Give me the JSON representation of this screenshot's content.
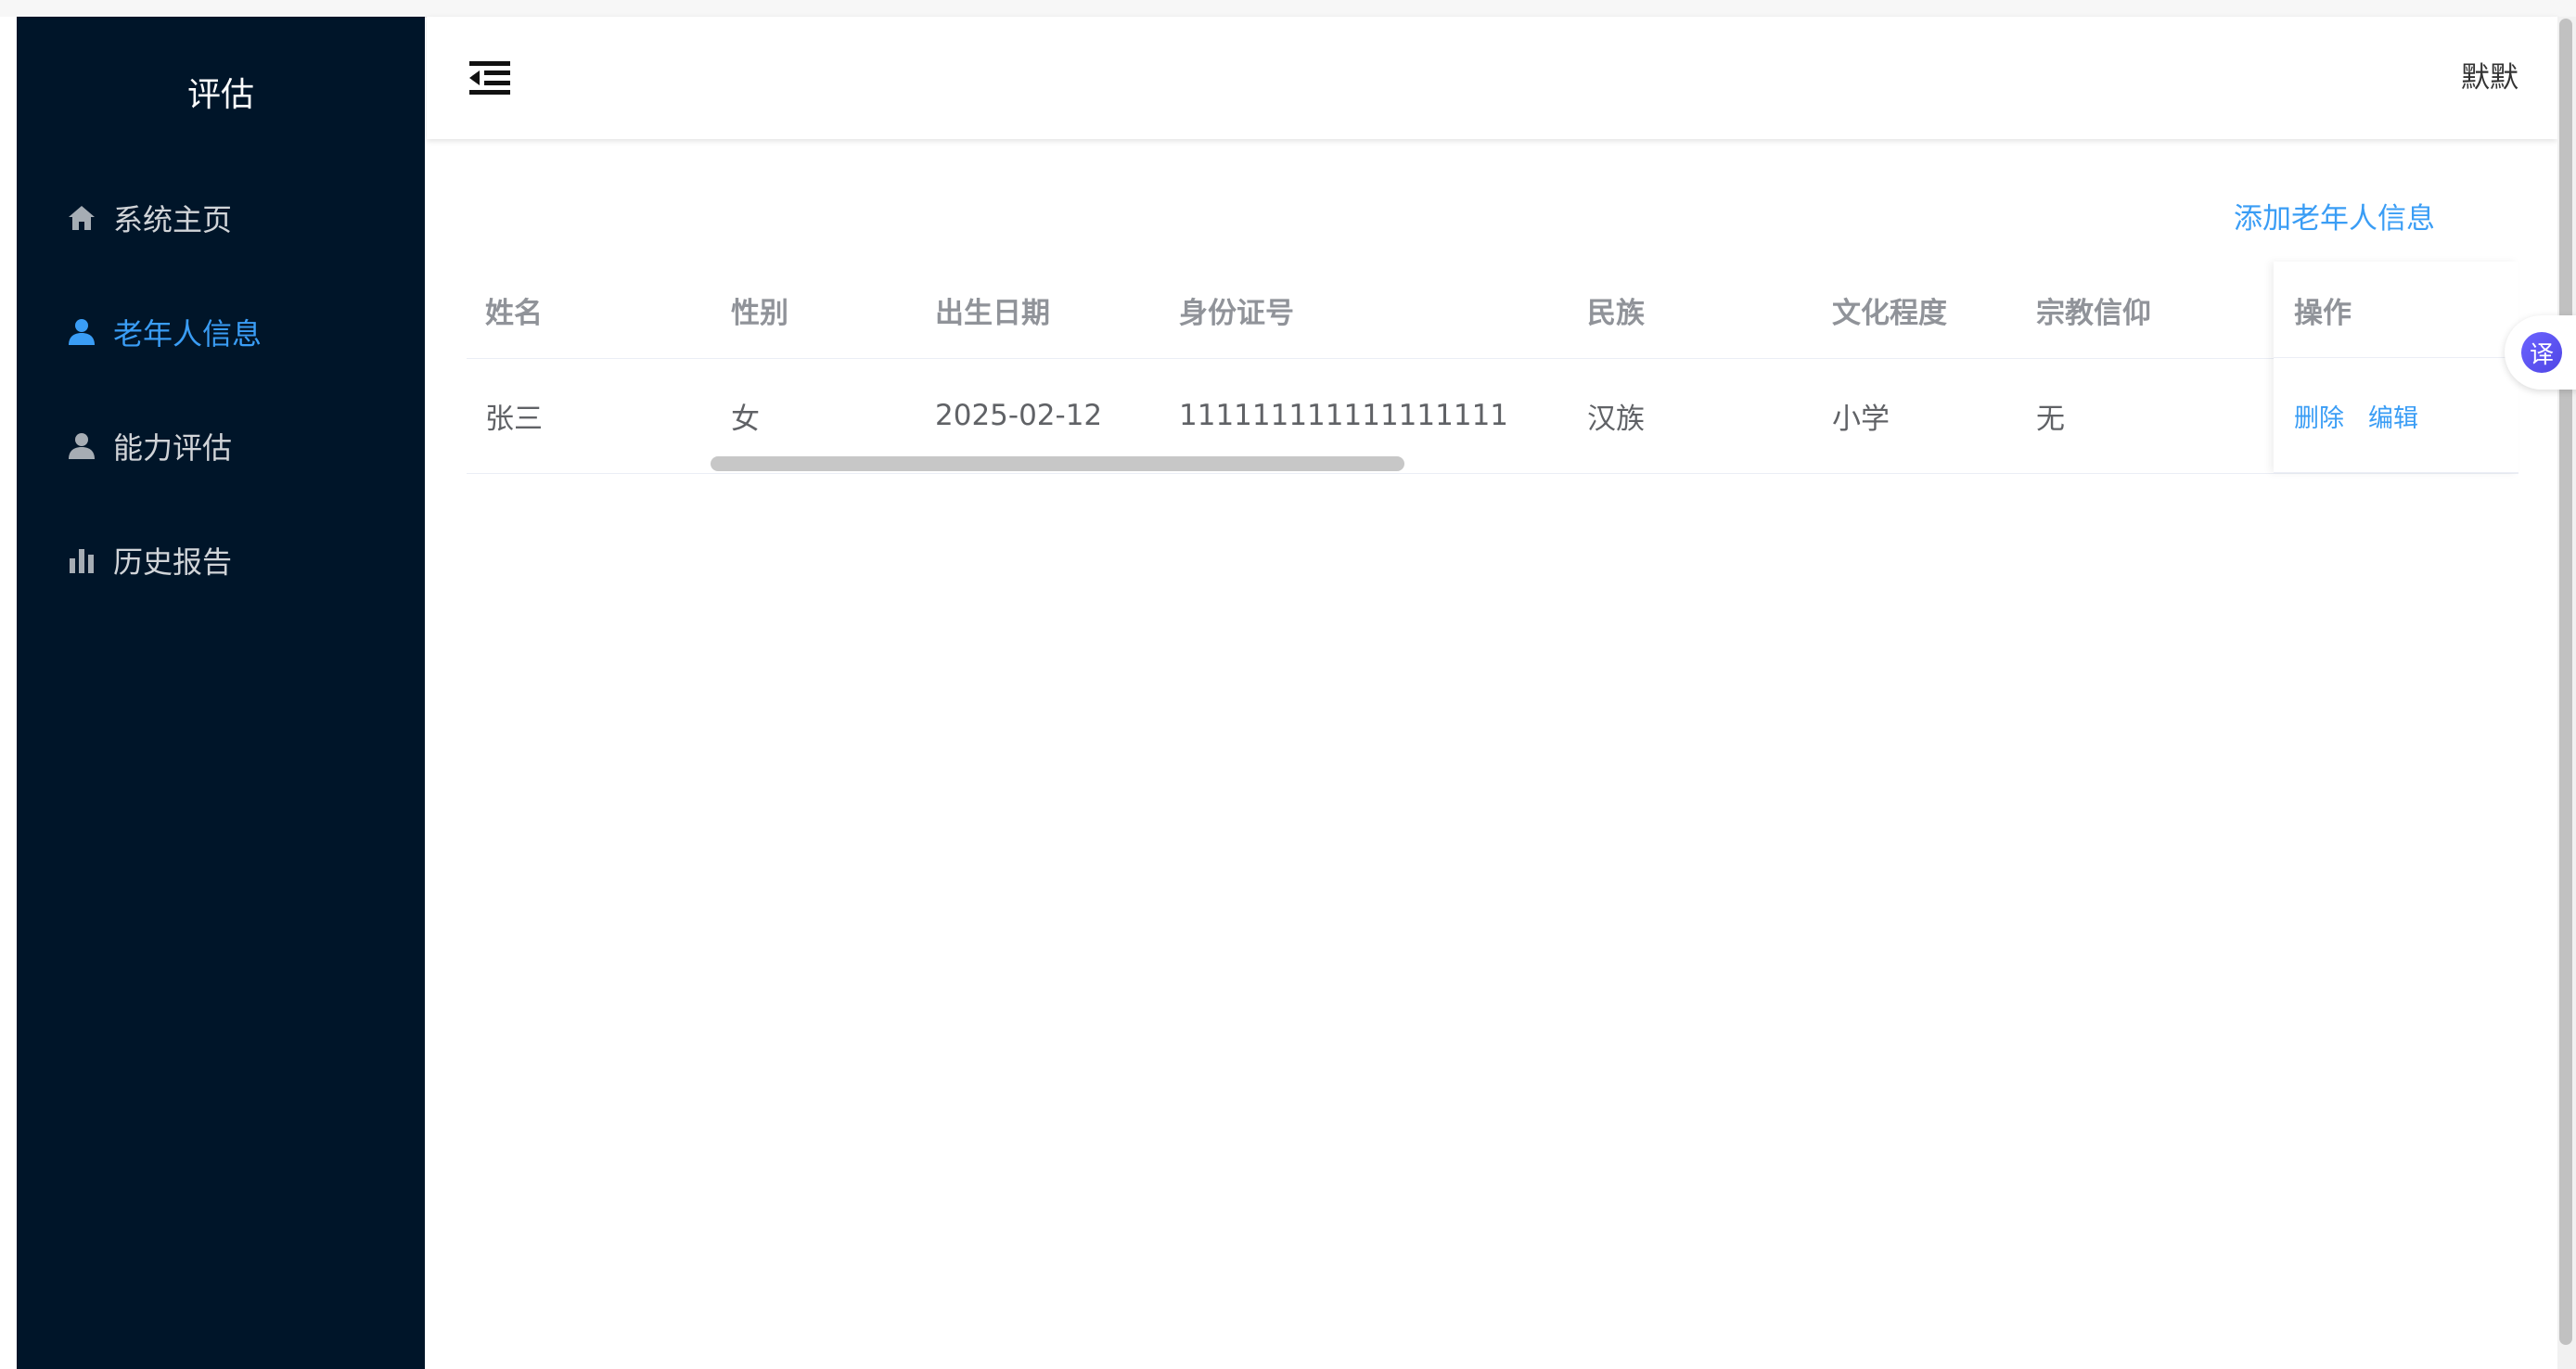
{
  "sidebar": {
    "title": "评估",
    "items": [
      {
        "label": "系统主页",
        "icon": "home-icon",
        "active": false
      },
      {
        "label": "老年人信息",
        "icon": "user-icon",
        "active": true
      },
      {
        "label": "能力评估",
        "icon": "user-icon",
        "active": false
      },
      {
        "label": "历史报告",
        "icon": "bar-chart-icon",
        "active": false
      }
    ]
  },
  "header": {
    "username": "默默"
  },
  "main": {
    "add_label": "添加老年人信息",
    "table": {
      "columns": [
        "姓名",
        "性别",
        "出生日期",
        "身份证号",
        "民族",
        "文化程度",
        "宗教信仰",
        "操作"
      ],
      "rows": [
        {
          "name": "张三",
          "gender": "女",
          "birth": "2025-02-12",
          "id_number": "111111111111111111",
          "ethnicity": "汉族",
          "education": "小学",
          "religion": "无",
          "actions": [
            "删除",
            "编辑"
          ]
        }
      ]
    }
  },
  "translate": {
    "label": "译"
  },
  "colors": {
    "sidebar_bg": "#001529",
    "accent": "#3a9df5"
  }
}
